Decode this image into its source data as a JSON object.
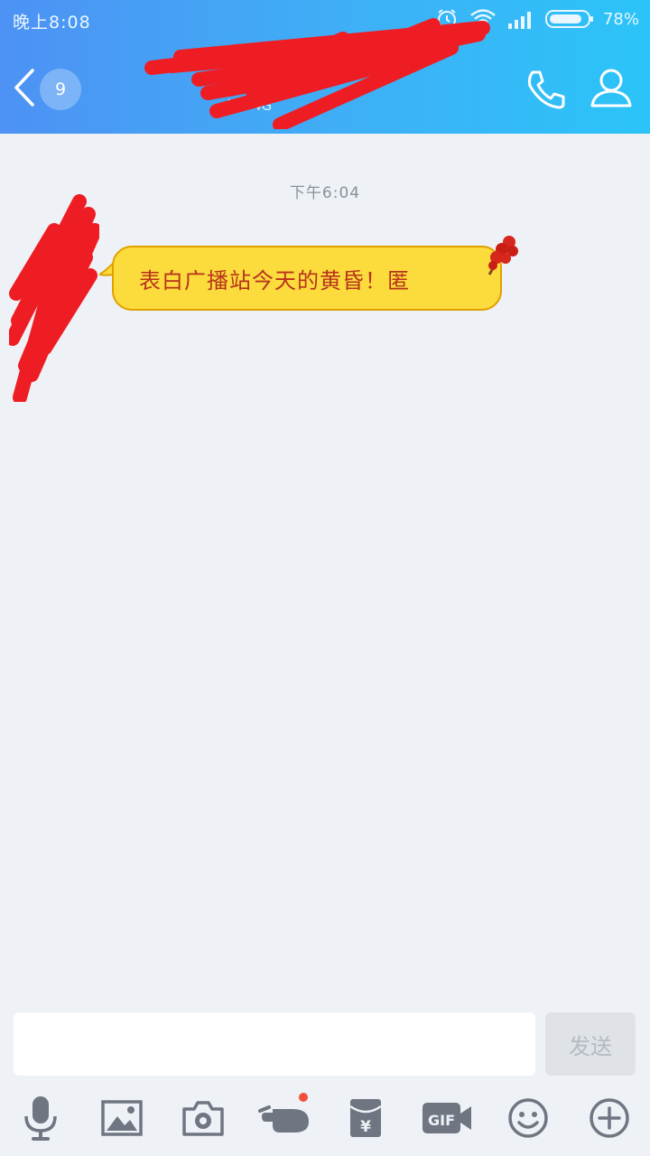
{
  "status_bar": {
    "time": "晚上8:08",
    "battery_percent": "78%"
  },
  "nav": {
    "unread_badge": "9",
    "status_text": "线 - 4G"
  },
  "chat": {
    "timestamp": "下午6:04",
    "messages": [
      {
        "sender": "other",
        "text": "表白广播站今天的黄昏！匿"
      }
    ]
  },
  "input": {
    "placeholder": "",
    "send_label": "发送"
  },
  "toolbar": {
    "items": [
      {
        "icon": "microphone-icon"
      },
      {
        "icon": "image-icon"
      },
      {
        "icon": "camera-icon"
      },
      {
        "icon": "poke-icon",
        "has_notification": true
      },
      {
        "icon": "red-envelope-icon"
      },
      {
        "icon": "gif-icon"
      },
      {
        "icon": "emoji-icon"
      },
      {
        "icon": "plus-icon"
      }
    ]
  },
  "colors": {
    "header_gradient_start": "#4d92f4",
    "header_gradient_end": "#2bc4f8",
    "bubble_fill": "#fbdc3c",
    "bubble_text": "#b8321c",
    "background": "#eef1f6",
    "icon_gray": "#6f7682",
    "notification_dot": "#f1503a"
  }
}
